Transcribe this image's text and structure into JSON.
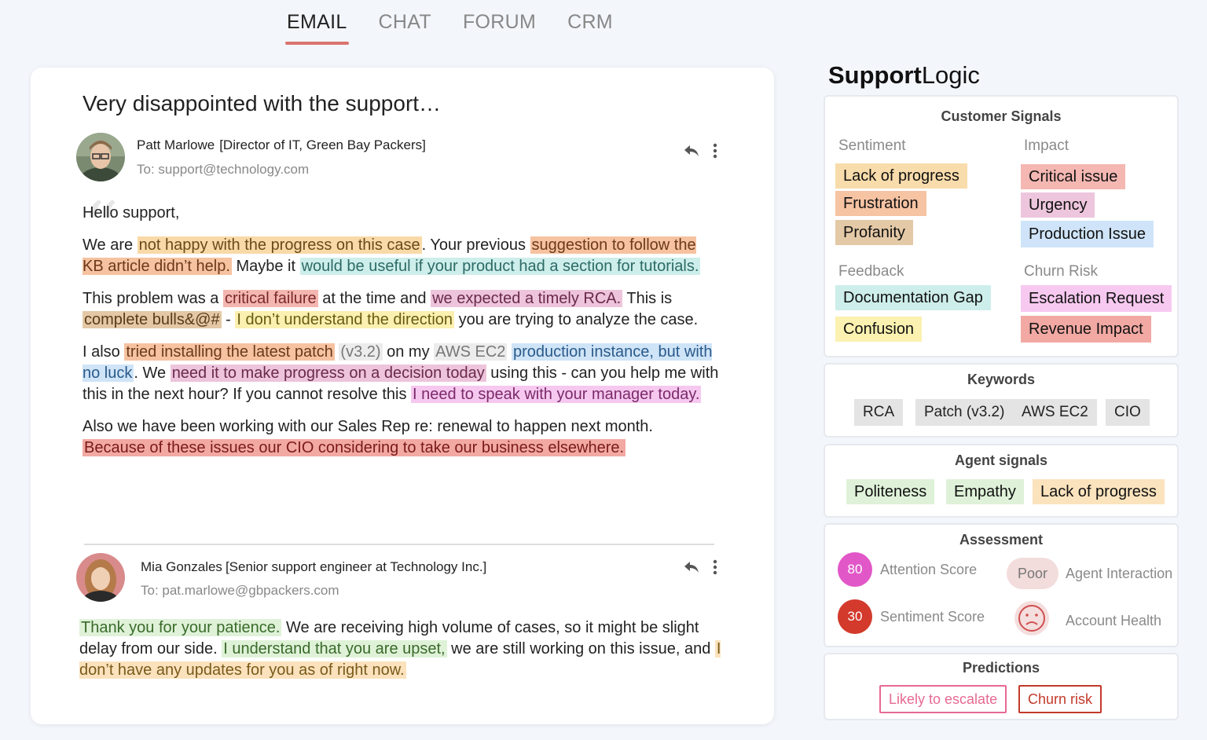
{
  "tabs": [
    {
      "label": "EMAIL",
      "active": true
    },
    {
      "label": "CHAT",
      "active": false
    },
    {
      "label": "FORUM",
      "active": false
    },
    {
      "label": "CRM",
      "active": false
    }
  ],
  "email": {
    "subject": "Very disappointed with the support…",
    "first": {
      "sender_name": "Patt Marlowe",
      "sender_role": "[Director of IT, Green Bay Packers]",
      "to": "To: support@technology.com",
      "greeting": "Hello support,",
      "p1": {
        "t1": "We are ",
        "h1": "not happy with the progress on this case",
        "t2": ". Your previous ",
        "h2": "suggestion to follow the KB article didn’t help.",
        "t3": " Maybe it ",
        "h3": "would be useful if your product had a section for tutorials."
      },
      "p2": {
        "t1": "This problem was a ",
        "h1": "critical failure",
        "t2": " at the time and ",
        "h2": "we expected a timely RCA.",
        "t3": " This is ",
        "h3": "complete bulls&@#",
        "t4": " - ",
        "h4": " I don’t understand the direction",
        "t5": " you are trying to analyze the case."
      },
      "p3": {
        "t1": "I also ",
        "h1": "tried installing the latest patch",
        "t2": " ",
        "h2": "(v3.2)",
        "t3": " on my ",
        "h3": "AWS EC2",
        "t4": " ",
        "h4": "production instance, but with no luck",
        "t5": ". We ",
        "h5": "need it to make progress on a decision today",
        "t6": " using this - can you help me with this in the next hour? If you cannot resolve this ",
        "h6": "I need to speak with your manager today."
      },
      "p4": {
        "t1": "Also we have been working with our Sales Rep re: renewal to happen next month. ",
        "h1": "Because of these issues our CIO considering to take our business elsewhere."
      }
    },
    "second": {
      "sender_name": "Mia Gonzales",
      "sender_role": "[Senior support engineer at Technology Inc.]",
      "to": "To: pat.marlowe@gbpackers.com",
      "p1": {
        "h1": "Thank you for your patience.",
        "t1": " We are receiving high volume of cases, so it might be slight delay from our side. ",
        "h2": "I understand that you are upset,",
        "t2": " we are still working on this issue, and ",
        "h3": "I don’t have any updates for you as of right now."
      }
    }
  },
  "brand": {
    "bold": "Support",
    "light": "Logic"
  },
  "customer_signals": {
    "title": "Customer Signals",
    "sentiment_label": "Sentiment",
    "sentiment": [
      {
        "label": "Lack of progress",
        "color": "#f9dcab"
      },
      {
        "label": "Frustration",
        "color": "#f6c3a3"
      },
      {
        "label": "Profanity",
        "color": "#e4c9a7"
      }
    ],
    "impact_label": "Impact",
    "impact": [
      {
        "label": "Critical issue",
        "color": "#f4b7b2"
      },
      {
        "label": "Urgency",
        "color": "#edc6dd"
      },
      {
        "label": "Production Issue",
        "color": "#cfe4f8"
      }
    ],
    "feedback_label": "Feedback",
    "feedback": [
      {
        "label": "Documentation Gap",
        "color": "#cdeeea"
      },
      {
        "label": "Confusion",
        "color": "#fbf1b0"
      }
    ],
    "churn_label": "Churn Risk",
    "churn": [
      {
        "label": "Escalation Request",
        "color": "#f7c9f0"
      },
      {
        "label": "Revenue Impact",
        "color": "#f2a9a3"
      }
    ]
  },
  "keywords": {
    "title": "Keywords",
    "items": [
      "RCA",
      "Patch (v3.2)",
      "AWS EC2",
      "CIO"
    ]
  },
  "agent_signals": {
    "title": "Agent signals",
    "items": [
      {
        "label": "Politeness",
        "color": "#dff2d9"
      },
      {
        "label": "Empathy",
        "color": "#dff2d9"
      },
      {
        "label": "Lack of progress",
        "color": "#fbe3be"
      }
    ]
  },
  "assessment": {
    "title": "Assessment",
    "attention_score": "80",
    "attention_label": "Attention Score",
    "attention_color": "#e257c8",
    "sentiment_score": "30",
    "sentiment_label": "Sentiment Score",
    "sentiment_color": "#d33a2c",
    "agent_rating": "Poor",
    "agent_label": "Agent Interaction",
    "account_label": "Account Health"
  },
  "predictions": {
    "title": "Predictions",
    "escalate": "Likely to escalate",
    "churn": "Churn risk",
    "escalate_color": "#e66a92",
    "churn_color": "#c23a2a"
  }
}
